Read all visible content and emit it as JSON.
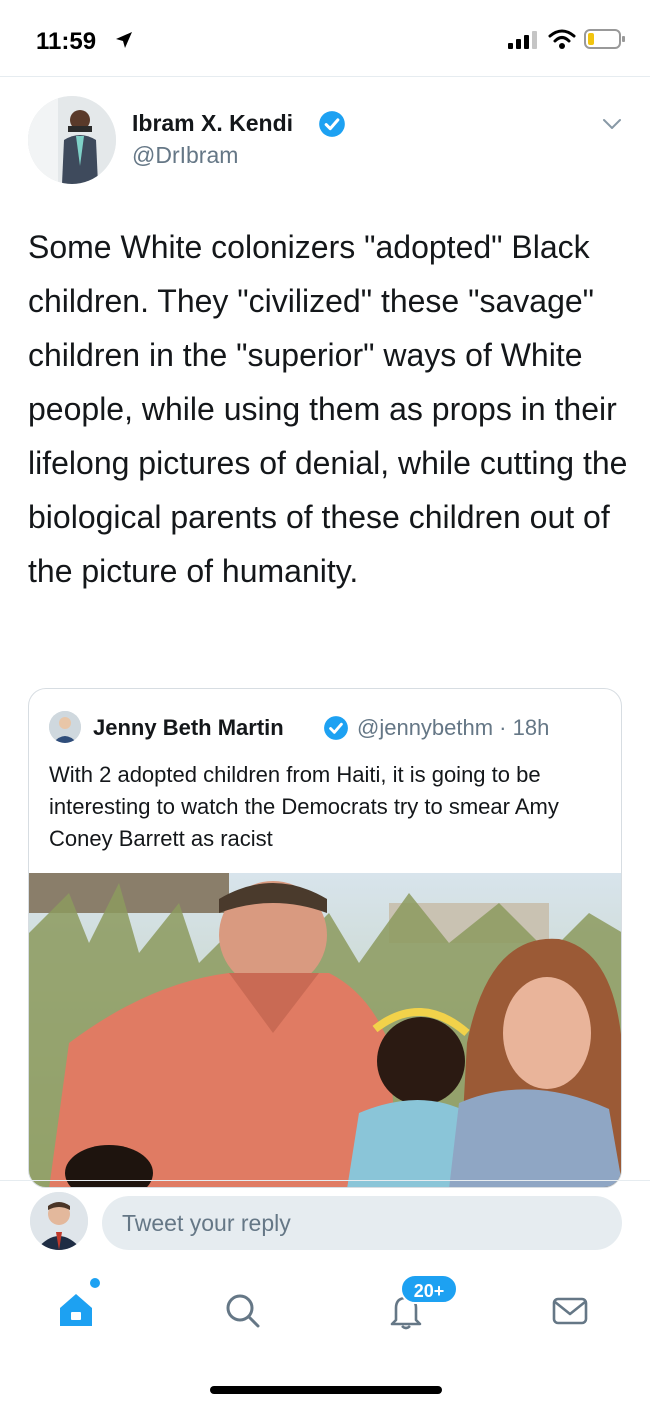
{
  "status_bar": {
    "time": "11:59"
  },
  "tweet": {
    "author_name": "Ibram X. Kendi",
    "author_handle": "@DrIbram",
    "text": "Some White colonizers \"adopted\" Black children. They \"civilized\" these \"savage\" children in the \"superior\" ways of White people, while using them as props in their lifelong pictures of denial, while cutting the biological parents of these children out of the picture of humanity."
  },
  "quoted_tweet": {
    "author_name": "Jenny Beth Martin",
    "author_handle": "@jennybethm · 18h",
    "text": "With 2 adopted children from Haiti, it is going to be interesting to watch the Democrats try to smear Amy Coney Barrett as racist"
  },
  "reply": {
    "placeholder": "Tweet your reply"
  },
  "tab_bar": {
    "notifications_badge": "20+"
  },
  "colors": {
    "accent": "#1da1f2",
    "text_primary": "#14171a",
    "text_secondary": "#657786",
    "divider": "#e6ecf0"
  },
  "icons": {
    "status": [
      "location-arrow-icon",
      "signal-icon",
      "wifi-icon",
      "battery-icon"
    ],
    "tweet": [
      "verified-icon",
      "chevron-down-icon"
    ],
    "tabs": [
      "home-icon",
      "search-icon",
      "notifications-icon",
      "messages-icon"
    ]
  }
}
